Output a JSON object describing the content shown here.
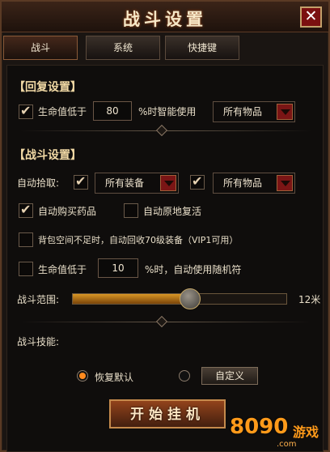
{
  "window": {
    "title": "战斗设置",
    "close_label": "✕"
  },
  "tabs": [
    {
      "label": "战斗",
      "active": true
    },
    {
      "label": "系统",
      "active": false
    },
    {
      "label": "快捷键",
      "active": false
    }
  ],
  "recovery": {
    "section_title": "【回复设置】",
    "hp_checkbox": {
      "label": "生命值低于",
      "checked": true
    },
    "hp_value": "80",
    "hp_suffix": "%时智能使用",
    "item_select": "所有物品"
  },
  "combat": {
    "section_title": "【战斗设置】",
    "autopick_label": "自动拾取:",
    "autopick_equipment": {
      "checked": true,
      "select": "所有装备"
    },
    "autopick_items": {
      "checked": true,
      "select": "所有物品"
    },
    "auto_buy_potion": {
      "label": "自动购买药品",
      "checked": true
    },
    "auto_revive": {
      "label": "自动原地复活",
      "checked": false
    },
    "auto_recycle": {
      "label": "背包空间不足时，自动回收70级装备（VIP1可用）",
      "checked": false
    },
    "hp_random_checkbox": {
      "label": "生命值低于",
      "checked": false
    },
    "hp_random_value": "10",
    "hp_random_suffix": "%时，自动使用随机符",
    "range_label": "战斗范围:",
    "range_value_label": "12米",
    "range_fraction": 0.55
  },
  "skills": {
    "label": "战斗技能:",
    "restore_default": {
      "label": "恢复默认",
      "selected": true
    },
    "custom": {
      "selected": false,
      "button_label": "自定义"
    }
  },
  "start_button": "开始挂机",
  "logo": {
    "text": "8090",
    "text2": "游戏",
    "domain": ".com"
  },
  "colors": {
    "accent": "#ff8a1e",
    "close_bg": "#7b1010"
  }
}
